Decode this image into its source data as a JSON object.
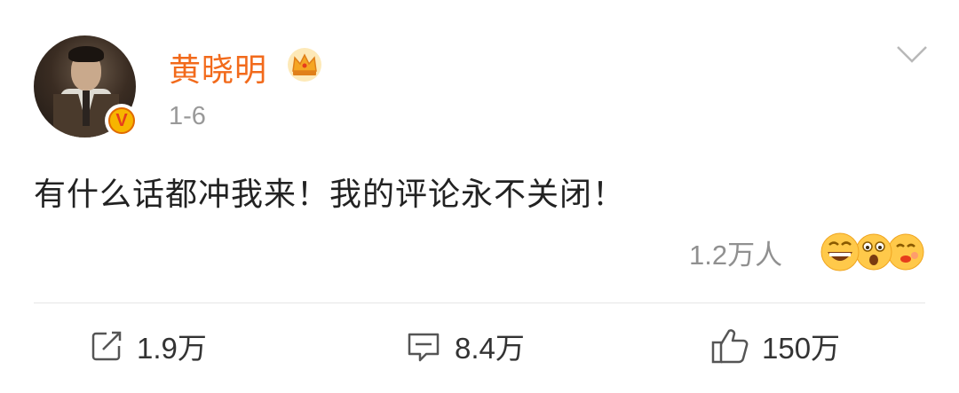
{
  "post": {
    "author": {
      "name": "黄晓明",
      "verified_badge": "V",
      "crown_icon": "crown-icon"
    },
    "date": "1-6",
    "content": "有什么话都冲我来！我的评论永不关闭！",
    "reactions": {
      "count_label": "1.2万人",
      "emojis": [
        "grin-emoji",
        "shocked-emoji",
        "kiss-emoji"
      ]
    }
  },
  "actions": {
    "repost": {
      "icon": "share-icon",
      "count": "1.9万"
    },
    "comment": {
      "icon": "comment-icon",
      "count": "8.4万"
    },
    "like": {
      "icon": "thumbs-up-icon",
      "count": "150万"
    }
  },
  "colors": {
    "username": "#f26a1b",
    "muted": "#999999",
    "text": "#222222"
  }
}
